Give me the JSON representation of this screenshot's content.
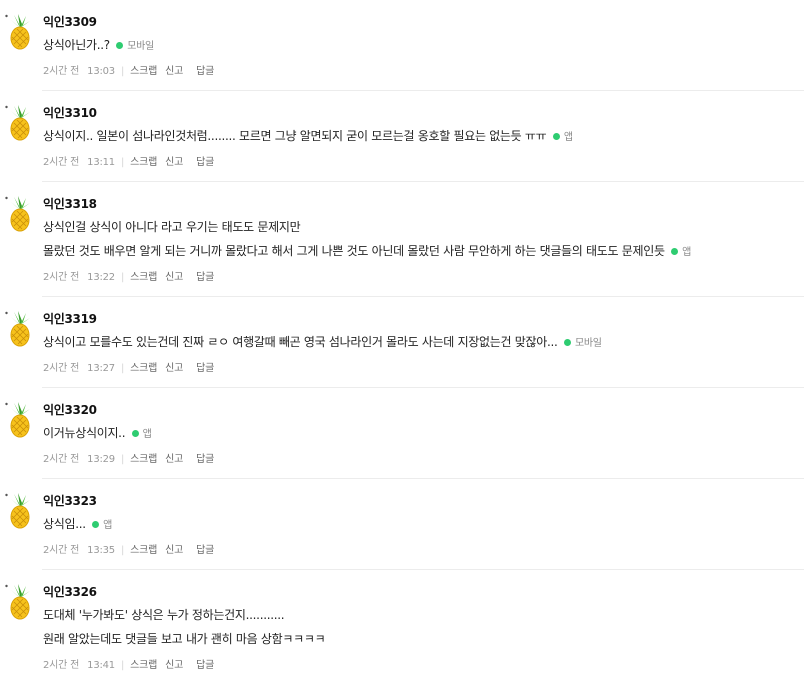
{
  "meta_labels": {
    "scrap": "스크랩",
    "report": "신고",
    "reply": "답글",
    "separator": "|"
  },
  "comments": [
    {
      "author": "익인3309",
      "lines": [
        "상식아닌가..?"
      ],
      "device": "모바일",
      "date": "2시간 전",
      "time": "13:03"
    },
    {
      "author": "익인3310",
      "lines": [
        "상식이지.. 일본이 섬나라인것처럼........ 모르면 그냥 알면되지 굳이 모르는걸 옹호할 필요는 없는듯 ㅠㅠ"
      ],
      "device": "앱",
      "date": "2시간 전",
      "time": "13:11"
    },
    {
      "author": "익인3318",
      "lines": [
        "상식인걸 상식이 아니다 라고 우기는 태도도 문제지만",
        "몰랐던 것도 배우면 알게 되는 거니까 몰랐다고 해서 그게 나쁜 것도 아닌데 몰랐던 사람 무안하게 하는 댓글들의 태도도 문제인듯"
      ],
      "device": "앱",
      "date": "2시간 전",
      "time": "13:22"
    },
    {
      "author": "익인3319",
      "lines": [
        "상식이고 모를수도 있는건데 진짜 ㄹㅇ 여행갈때 빼곤 영국 섬나라인거 몰라도 사는데 지장없는건 맞잖아..."
      ],
      "device": "모바일",
      "date": "2시간 전",
      "time": "13:27"
    },
    {
      "author": "익인3320",
      "lines": [
        "이거뉴상식이지.."
      ],
      "device": "앱",
      "date": "2시간 전",
      "time": "13:29"
    },
    {
      "author": "익인3323",
      "lines": [
        "상식임..."
      ],
      "device": "앱",
      "date": "2시간 전",
      "time": "13:35"
    },
    {
      "author": "익인3326",
      "lines": [
        "도대체 '누가봐도' 상식은 누가 정하는건지...........",
        "원래 알았는데도 댓글들 보고 내가 괜히 마음 상함ㅋㅋㅋㅋ"
      ],
      "device": "",
      "date": "2시간 전",
      "time": "13:41"
    }
  ]
}
